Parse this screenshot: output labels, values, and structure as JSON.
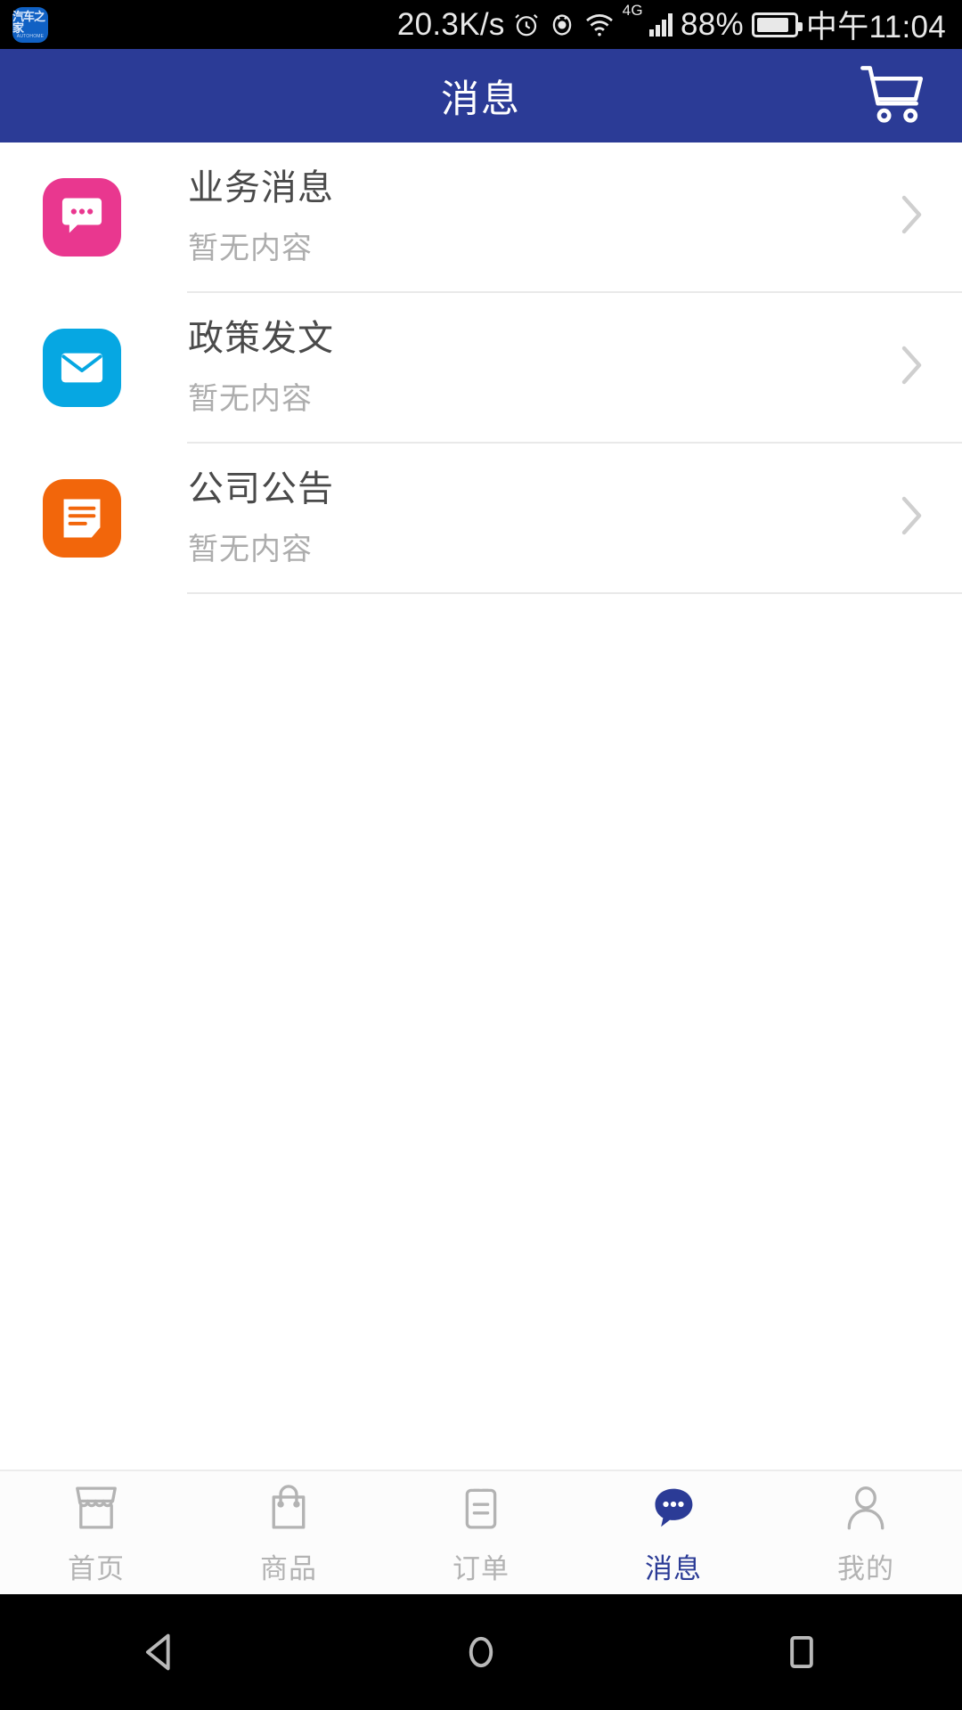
{
  "statusbar": {
    "app_badge_line1": "汽车之家",
    "app_badge_line2": "AUTOHOME",
    "network_speed": "20.3K/s",
    "alarm_icon": "alarm-icon",
    "eye_icon": "eye-icon",
    "wifi_icon": "wifi-icon",
    "network_type": "4G",
    "signal_icon": "signal-bars-icon",
    "battery_percent": "88%",
    "battery_icon": "battery-icon",
    "time": "中午11:04"
  },
  "header": {
    "title": "消息",
    "cart_icon": "shopping-cart-icon",
    "background_color": "#2b3b96"
  },
  "list": {
    "items": [
      {
        "title": "业务消息",
        "subtitle": "暂无内容",
        "icon": "chat-bubble-icon",
        "icon_color": "#e9378f",
        "chevron": "chevron-right-icon"
      },
      {
        "title": "政策发文",
        "subtitle": "暂无内容",
        "icon": "envelope-icon",
        "icon_color": "#06a7e2",
        "chevron": "chevron-right-icon"
      },
      {
        "title": "公司公告",
        "subtitle": "暂无内容",
        "icon": "document-icon",
        "icon_color": "#f2660b",
        "chevron": "chevron-right-icon"
      }
    ]
  },
  "tabbar": {
    "active_color": "#2b3b96",
    "inactive_color": "#b3b3b3",
    "tabs": [
      {
        "label": "首页",
        "icon": "storefront-icon",
        "active": false
      },
      {
        "label": "商品",
        "icon": "shopping-bag-icon",
        "active": false
      },
      {
        "label": "订单",
        "icon": "clipboard-icon",
        "active": false
      },
      {
        "label": "消息",
        "icon": "chat-bubble-icon",
        "active": true
      },
      {
        "label": "我的",
        "icon": "person-icon",
        "active": false
      }
    ]
  },
  "navbar": {
    "back_icon": "triangle-back-icon",
    "home_icon": "circle-home-icon",
    "recents_icon": "square-recents-icon"
  }
}
